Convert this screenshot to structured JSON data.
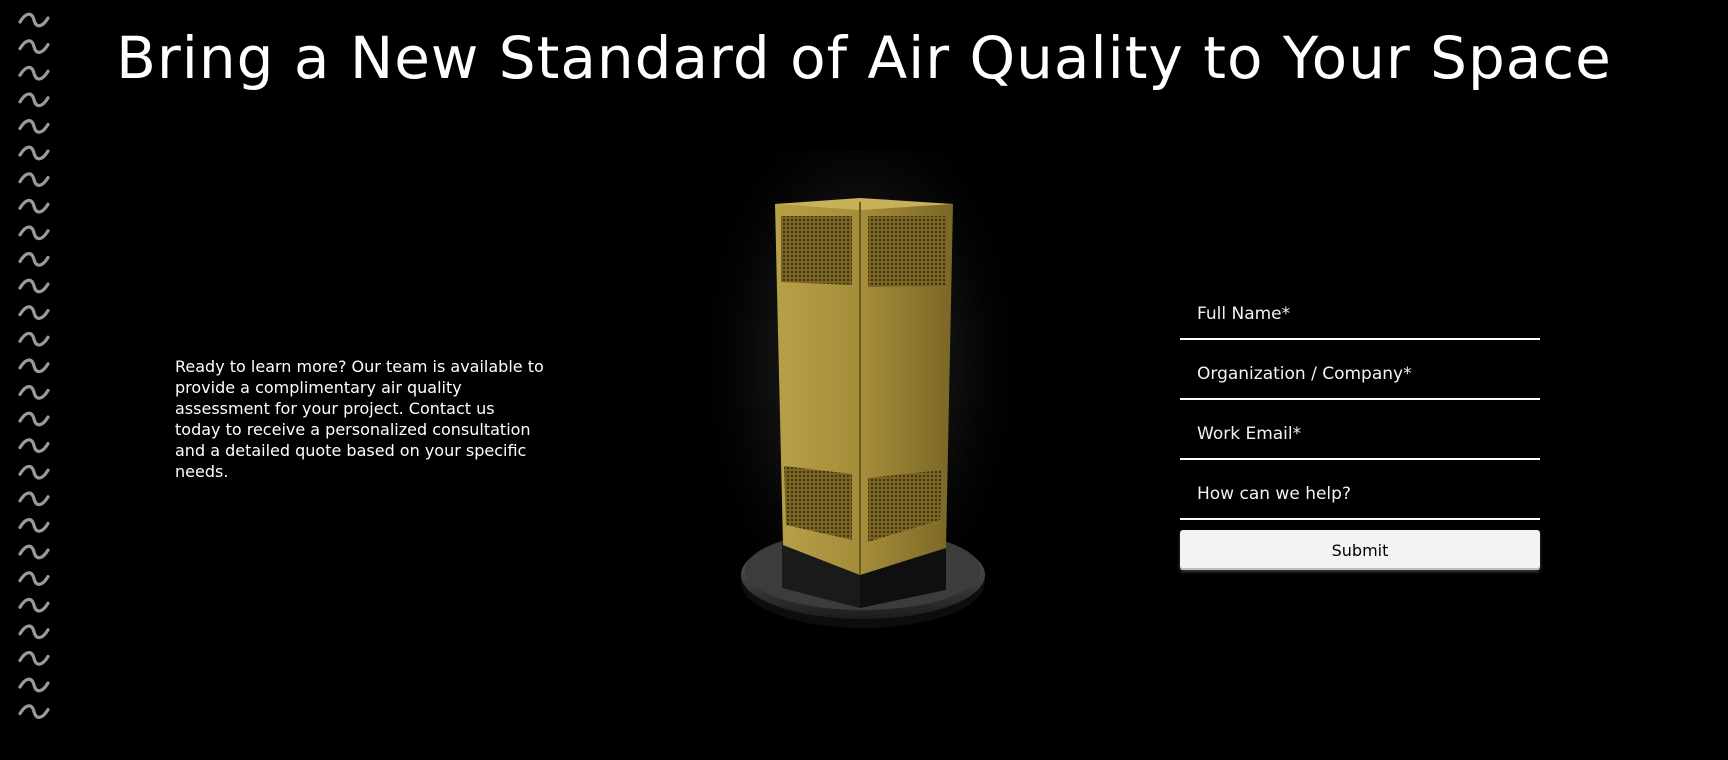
{
  "hero": {
    "title": "Bring a New Standard of Air Quality to Your Space",
    "intro": "Ready to learn more? Our team is available to provide a complimentary air quality assessment for your project. Contact us today to receive a personalized consultation and a detailed quote based on your specific needs."
  },
  "form": {
    "fields": [
      {
        "placeholder": "Full Name*"
      },
      {
        "placeholder": "Organization / Company*"
      },
      {
        "placeholder": "Work Email*"
      },
      {
        "placeholder": "How can we help?"
      }
    ],
    "submit_label": "Submit"
  },
  "decor": {
    "wave_icon": "wave-icon",
    "product_image": "air-purifier-tower"
  },
  "colors": {
    "background": "#000000",
    "text": "#ffffff",
    "product_gold": "#b39a3e",
    "wave_gray": "#9a9a9a"
  }
}
